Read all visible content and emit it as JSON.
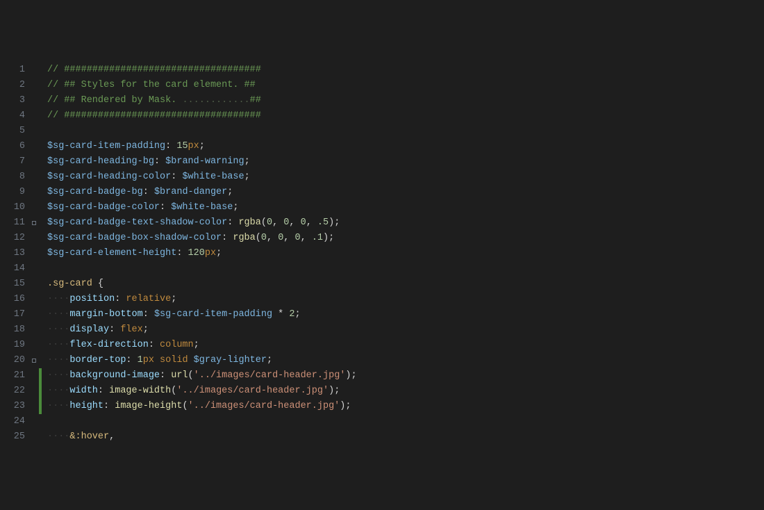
{
  "gutter": [
    "1",
    "2",
    "3",
    "4",
    "5",
    "6",
    "7",
    "8",
    "9",
    "10",
    "11",
    "12",
    "13",
    "14",
    "15",
    "16",
    "17",
    "18",
    "19",
    "20",
    "21",
    "22",
    "23",
    "24",
    "25"
  ],
  "markers": [
    "",
    "",
    "",
    "",
    "",
    "",
    "",
    "",
    "",
    "",
    "dot",
    "",
    "",
    "",
    "",
    "",
    "",
    "",
    "",
    "dot",
    "",
    "",
    "",
    "",
    ""
  ],
  "modified": [
    "",
    "",
    "",
    "",
    "",
    "",
    "",
    "",
    "",
    "",
    "",
    "",
    "",
    "",
    "",
    "",
    "",
    "",
    "",
    "",
    "add",
    "add",
    "add",
    "",
    ""
  ],
  "lines": [
    [
      {
        "c": "tk-comment",
        "t": "// ###################################"
      }
    ],
    [
      {
        "c": "tk-comment",
        "t": "// ## Styles for the card element. ##"
      }
    ],
    [
      {
        "c": "tk-comment",
        "t": "// ## Rendered by Mask. "
      },
      {
        "c": "tk-dots",
        "t": "............"
      },
      {
        "c": "tk-comment",
        "t": "##"
      }
    ],
    [
      {
        "c": "tk-comment",
        "t": "// ###################################"
      }
    ],
    [],
    [
      {
        "c": "tk-var",
        "t": "$sg-card-item-padding"
      },
      {
        "c": "tk-op",
        "t": ": "
      },
      {
        "c": "tk-num",
        "t": "15"
      },
      {
        "c": "tk-kw",
        "t": "px"
      },
      {
        "c": "tk-op",
        "t": ";"
      }
    ],
    [
      {
        "c": "tk-var",
        "t": "$sg-card-heading-bg"
      },
      {
        "c": "tk-op",
        "t": ": "
      },
      {
        "c": "tk-var",
        "t": "$brand-warning"
      },
      {
        "c": "tk-op",
        "t": ";"
      }
    ],
    [
      {
        "c": "tk-var",
        "t": "$sg-card-heading-color"
      },
      {
        "c": "tk-op",
        "t": ": "
      },
      {
        "c": "tk-var",
        "t": "$white-base"
      },
      {
        "c": "tk-op",
        "t": ";"
      }
    ],
    [
      {
        "c": "tk-var",
        "t": "$sg-card-badge-bg"
      },
      {
        "c": "tk-op",
        "t": ": "
      },
      {
        "c": "tk-var",
        "t": "$brand-danger"
      },
      {
        "c": "tk-op",
        "t": ";"
      }
    ],
    [
      {
        "c": "tk-var",
        "t": "$sg-card-badge-color"
      },
      {
        "c": "tk-op",
        "t": ": "
      },
      {
        "c": "tk-var",
        "t": "$white-base"
      },
      {
        "c": "tk-op",
        "t": ";"
      }
    ],
    [
      {
        "c": "tk-var",
        "t": "$sg-card-badge-text-shadow-color"
      },
      {
        "c": "tk-op",
        "t": ": "
      },
      {
        "c": "tk-func",
        "t": "rgba"
      },
      {
        "c": "tk-op",
        "t": "("
      },
      {
        "c": "tk-num",
        "t": "0"
      },
      {
        "c": "tk-op",
        "t": ", "
      },
      {
        "c": "tk-num",
        "t": "0"
      },
      {
        "c": "tk-op",
        "t": ", "
      },
      {
        "c": "tk-num",
        "t": "0"
      },
      {
        "c": "tk-op",
        "t": ", "
      },
      {
        "c": "tk-num",
        "t": ".5"
      },
      {
        "c": "tk-op",
        "t": ");"
      }
    ],
    [
      {
        "c": "tk-var",
        "t": "$sg-card-badge-box-shadow-color"
      },
      {
        "c": "tk-op",
        "t": ": "
      },
      {
        "c": "tk-func",
        "t": "rgba"
      },
      {
        "c": "tk-op",
        "t": "("
      },
      {
        "c": "tk-num",
        "t": "0"
      },
      {
        "c": "tk-op",
        "t": ", "
      },
      {
        "c": "tk-num",
        "t": "0"
      },
      {
        "c": "tk-op",
        "t": ", "
      },
      {
        "c": "tk-num",
        "t": "0"
      },
      {
        "c": "tk-op",
        "t": ", "
      },
      {
        "c": "tk-num",
        "t": ".1"
      },
      {
        "c": "tk-op",
        "t": ");"
      }
    ],
    [
      {
        "c": "tk-var",
        "t": "$sg-card-element-height"
      },
      {
        "c": "tk-op",
        "t": ": "
      },
      {
        "c": "tk-num",
        "t": "120"
      },
      {
        "c": "tk-kw",
        "t": "px"
      },
      {
        "c": "tk-op",
        "t": ";"
      }
    ],
    [],
    [
      {
        "c": "tk-sel",
        "t": ".sg-card"
      },
      {
        "c": "tk-op",
        "t": " "
      },
      {
        "c": "tk-brace",
        "t": "{"
      }
    ],
    [
      {
        "c": "indent-guide",
        "t": "····"
      },
      {
        "c": "tk-prop",
        "t": "position"
      },
      {
        "c": "tk-op",
        "t": ": "
      },
      {
        "c": "tk-kw",
        "t": "relative"
      },
      {
        "c": "tk-op",
        "t": ";"
      }
    ],
    [
      {
        "c": "indent-guide",
        "t": "····"
      },
      {
        "c": "tk-prop",
        "t": "margin-bottom"
      },
      {
        "c": "tk-op",
        "t": ": "
      },
      {
        "c": "tk-var",
        "t": "$sg-card-item-padding"
      },
      {
        "c": "tk-op",
        "t": " * "
      },
      {
        "c": "tk-num",
        "t": "2"
      },
      {
        "c": "tk-op",
        "t": ";"
      }
    ],
    [
      {
        "c": "indent-guide",
        "t": "····"
      },
      {
        "c": "tk-prop",
        "t": "display"
      },
      {
        "c": "tk-op",
        "t": ": "
      },
      {
        "c": "tk-kw",
        "t": "flex"
      },
      {
        "c": "tk-op",
        "t": ";"
      }
    ],
    [
      {
        "c": "indent-guide",
        "t": "····"
      },
      {
        "c": "tk-prop",
        "t": "flex-direction"
      },
      {
        "c": "tk-op",
        "t": ": "
      },
      {
        "c": "tk-kw",
        "t": "column"
      },
      {
        "c": "tk-op",
        "t": ";"
      }
    ],
    [
      {
        "c": "indent-guide",
        "t": "····"
      },
      {
        "c": "tk-prop",
        "t": "border-top"
      },
      {
        "c": "tk-op",
        "t": ": "
      },
      {
        "c": "tk-num",
        "t": "1"
      },
      {
        "c": "tk-kw",
        "t": "px"
      },
      {
        "c": "tk-op",
        "t": " "
      },
      {
        "c": "tk-kw",
        "t": "solid"
      },
      {
        "c": "tk-op",
        "t": " "
      },
      {
        "c": "tk-var",
        "t": "$gray-lighter"
      },
      {
        "c": "tk-op",
        "t": ";"
      }
    ],
    [
      {
        "c": "indent-guide",
        "t": "····"
      },
      {
        "c": "tk-prop",
        "t": "background-image"
      },
      {
        "c": "tk-op",
        "t": ": "
      },
      {
        "c": "tk-func",
        "t": "url"
      },
      {
        "c": "tk-op",
        "t": "("
      },
      {
        "c": "tk-str",
        "t": "'../images/card-header.jpg'"
      },
      {
        "c": "tk-op",
        "t": ");"
      }
    ],
    [
      {
        "c": "indent-guide",
        "t": "····"
      },
      {
        "c": "tk-prop",
        "t": "width"
      },
      {
        "c": "tk-op",
        "t": ": "
      },
      {
        "c": "tk-func",
        "t": "image-width"
      },
      {
        "c": "tk-op",
        "t": "("
      },
      {
        "c": "tk-str",
        "t": "'../images/card-header.jpg'"
      },
      {
        "c": "tk-op",
        "t": ");"
      }
    ],
    [
      {
        "c": "indent-guide",
        "t": "····"
      },
      {
        "c": "tk-prop",
        "t": "height"
      },
      {
        "c": "tk-op",
        "t": ": "
      },
      {
        "c": "tk-func",
        "t": "image-height"
      },
      {
        "c": "tk-op",
        "t": "("
      },
      {
        "c": "tk-str",
        "t": "'../images/card-header.jpg'"
      },
      {
        "c": "tk-op",
        "t": ");"
      }
    ],
    [],
    [
      {
        "c": "indent-guide",
        "t": "····"
      },
      {
        "c": "tk-sel",
        "t": "&:hover"
      },
      {
        "c": "tk-op",
        "t": ","
      }
    ]
  ]
}
